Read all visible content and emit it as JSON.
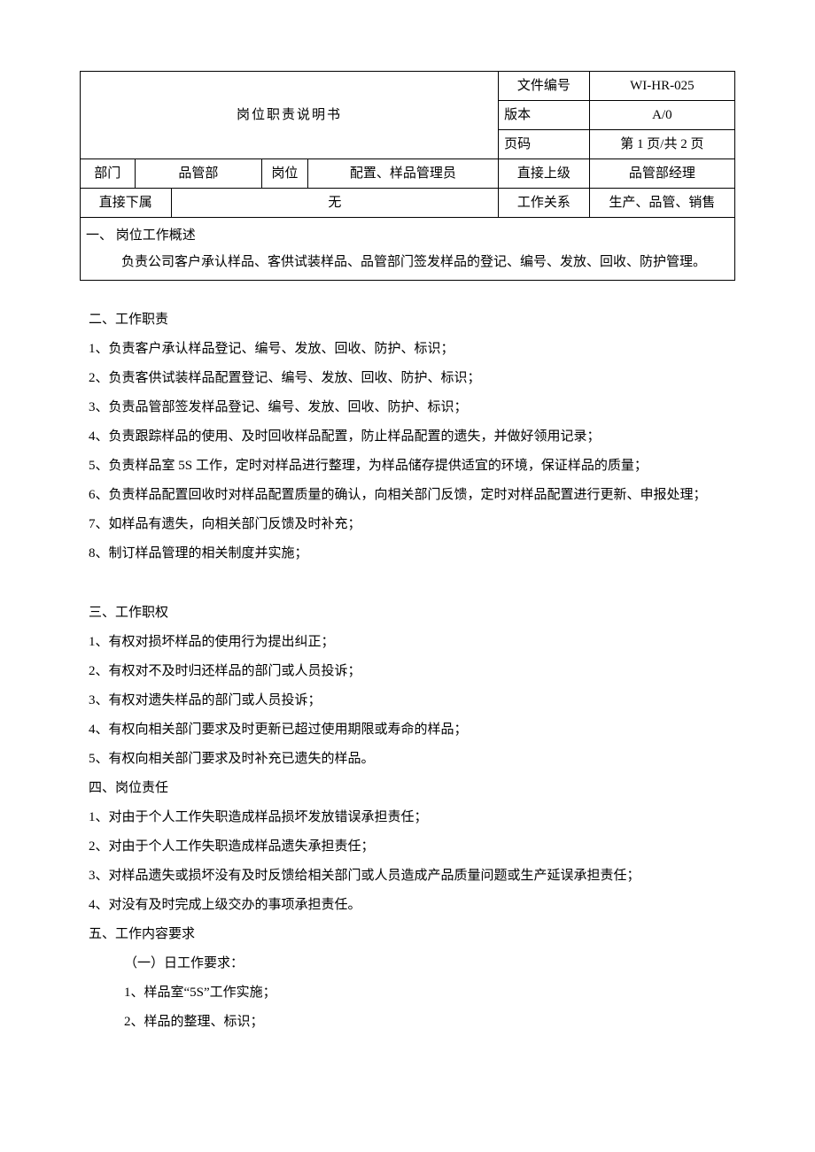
{
  "header": {
    "title": "岗位职责说明书",
    "meta": {
      "doc_no_label": "文件编号",
      "doc_no_value": "WI-HR-025",
      "version_label": "版本",
      "version_value": "A/0",
      "page_label": "页码",
      "page_value": "第 1 页/共 2 页"
    },
    "row1": {
      "dept_label": "部门",
      "dept_value": "品管部",
      "position_label": "岗位",
      "position_value": "配置、样品管理员",
      "supervisor_label": "直接上级",
      "supervisor_value": "品管部经理"
    },
    "row2": {
      "subordinate_label": "直接下属",
      "subordinate_value": "无",
      "relation_label": "工作关系",
      "relation_value": "生产、品管、销售"
    },
    "overview": {
      "heading": "一、    岗位工作概述",
      "text": "负责公司客户承认样品、客供试装样品、品管部门签发样品的登记、编号、发放、回收、防护管理。"
    }
  },
  "sections": {
    "s2_title": "二、工作职责",
    "s2_items": [
      "1、负责客户承认样品登记、编号、发放、回收、防护、标识；",
      "2、负责客供试装样品配置登记、编号、发放、回收、防护、标识；",
      "3、负责品管部签发样品登记、编号、发放、回收、防护、标识；",
      "4、负责跟踪样品的使用、及时回收样品配置，防止样品配置的遗失，并做好领用记录；",
      "5、负责样品室 5S 工作，定时对样品进行整理，为样品储存提供适宜的环境，保证样品的质量；",
      "6、负责样品配置回收时对样品配置质量的确认，向相关部门反馈，定时对样品配置进行更新、申报处理；",
      "7、如样品有遗失，向相关部门反馈及时补充；",
      "8、制订样品管理的相关制度并实施；"
    ],
    "s3_title": "三、工作职权",
    "s3_items": [
      "1、有权对损坏样品的使用行为提出纠正；",
      "2、有权对不及时归还样品的部门或人员投诉；",
      "3、有权对遗失样品的部门或人员投诉；",
      "4、有权向相关部门要求及时更新已超过使用期限或寿命的样品；",
      "5、有权向相关部门要求及时补充已遗失的样品。"
    ],
    "s4_title": "四、岗位责任",
    "s4_items": [
      "1、对由于个人工作失职造成样品损坏发放错误承担责任；",
      "2、对由于个人工作失职造成样品遗失承担责任；",
      "3、对样品遗失或损坏没有及时反馈给相关部门或人员造成产品质量问题或生产延误承担责任；",
      "4、对没有及时完成上级交办的事项承担责任。"
    ],
    "s5_title": "五、工作内容要求",
    "s5_sub1": "（一）日工作要求：",
    "s5_sub1_items": [
      "1、样品室“5S”工作实施；",
      "2、样品的整理、标识；"
    ]
  }
}
